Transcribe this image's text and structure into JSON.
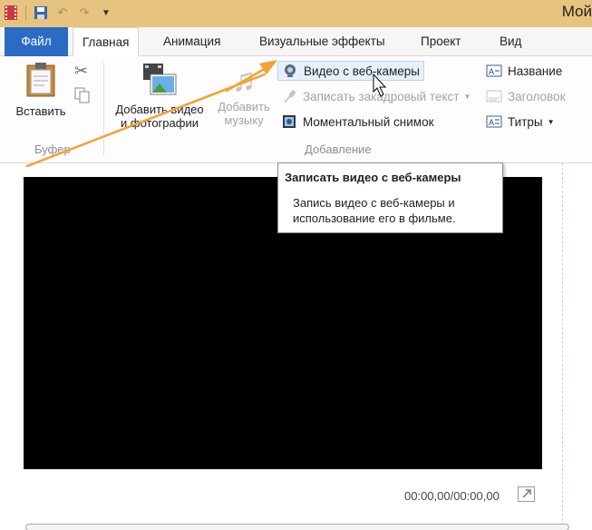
{
  "window": {
    "title": "Мой"
  },
  "tabs": [
    {
      "label": "Файл"
    },
    {
      "label": "Главная"
    },
    {
      "label": "Анимация"
    },
    {
      "label": "Визуальные эффекты"
    },
    {
      "label": "Проект"
    },
    {
      "label": "Вид"
    }
  ],
  "ribbon": {
    "buffer": {
      "label": "Буфер",
      "paste": "Вставить"
    },
    "add": {
      "label": "Добавление",
      "add_video_line1": "Добавить видео",
      "add_video_line2": "и фотографии",
      "add_music_line1": "Добавить",
      "add_music_line2": "музыку",
      "webcam": "Видео с веб-камеры",
      "narration": "Записать закадровый текст",
      "snapshot": "Моментальный снимок",
      "title": "Название",
      "caption": "Заголовок",
      "credits": "Титры"
    }
  },
  "tooltip": {
    "title": "Записать видео с веб-камеры",
    "line1": "Запись видео с веб-камеры и",
    "line2": "использование его в фильме."
  },
  "player": {
    "timecode": "00:00,00/00:00,00"
  },
  "colors": {
    "file_tab": "#2a6bc4",
    "annotation": "#f5a030",
    "titlebar": "#e6c47f"
  }
}
